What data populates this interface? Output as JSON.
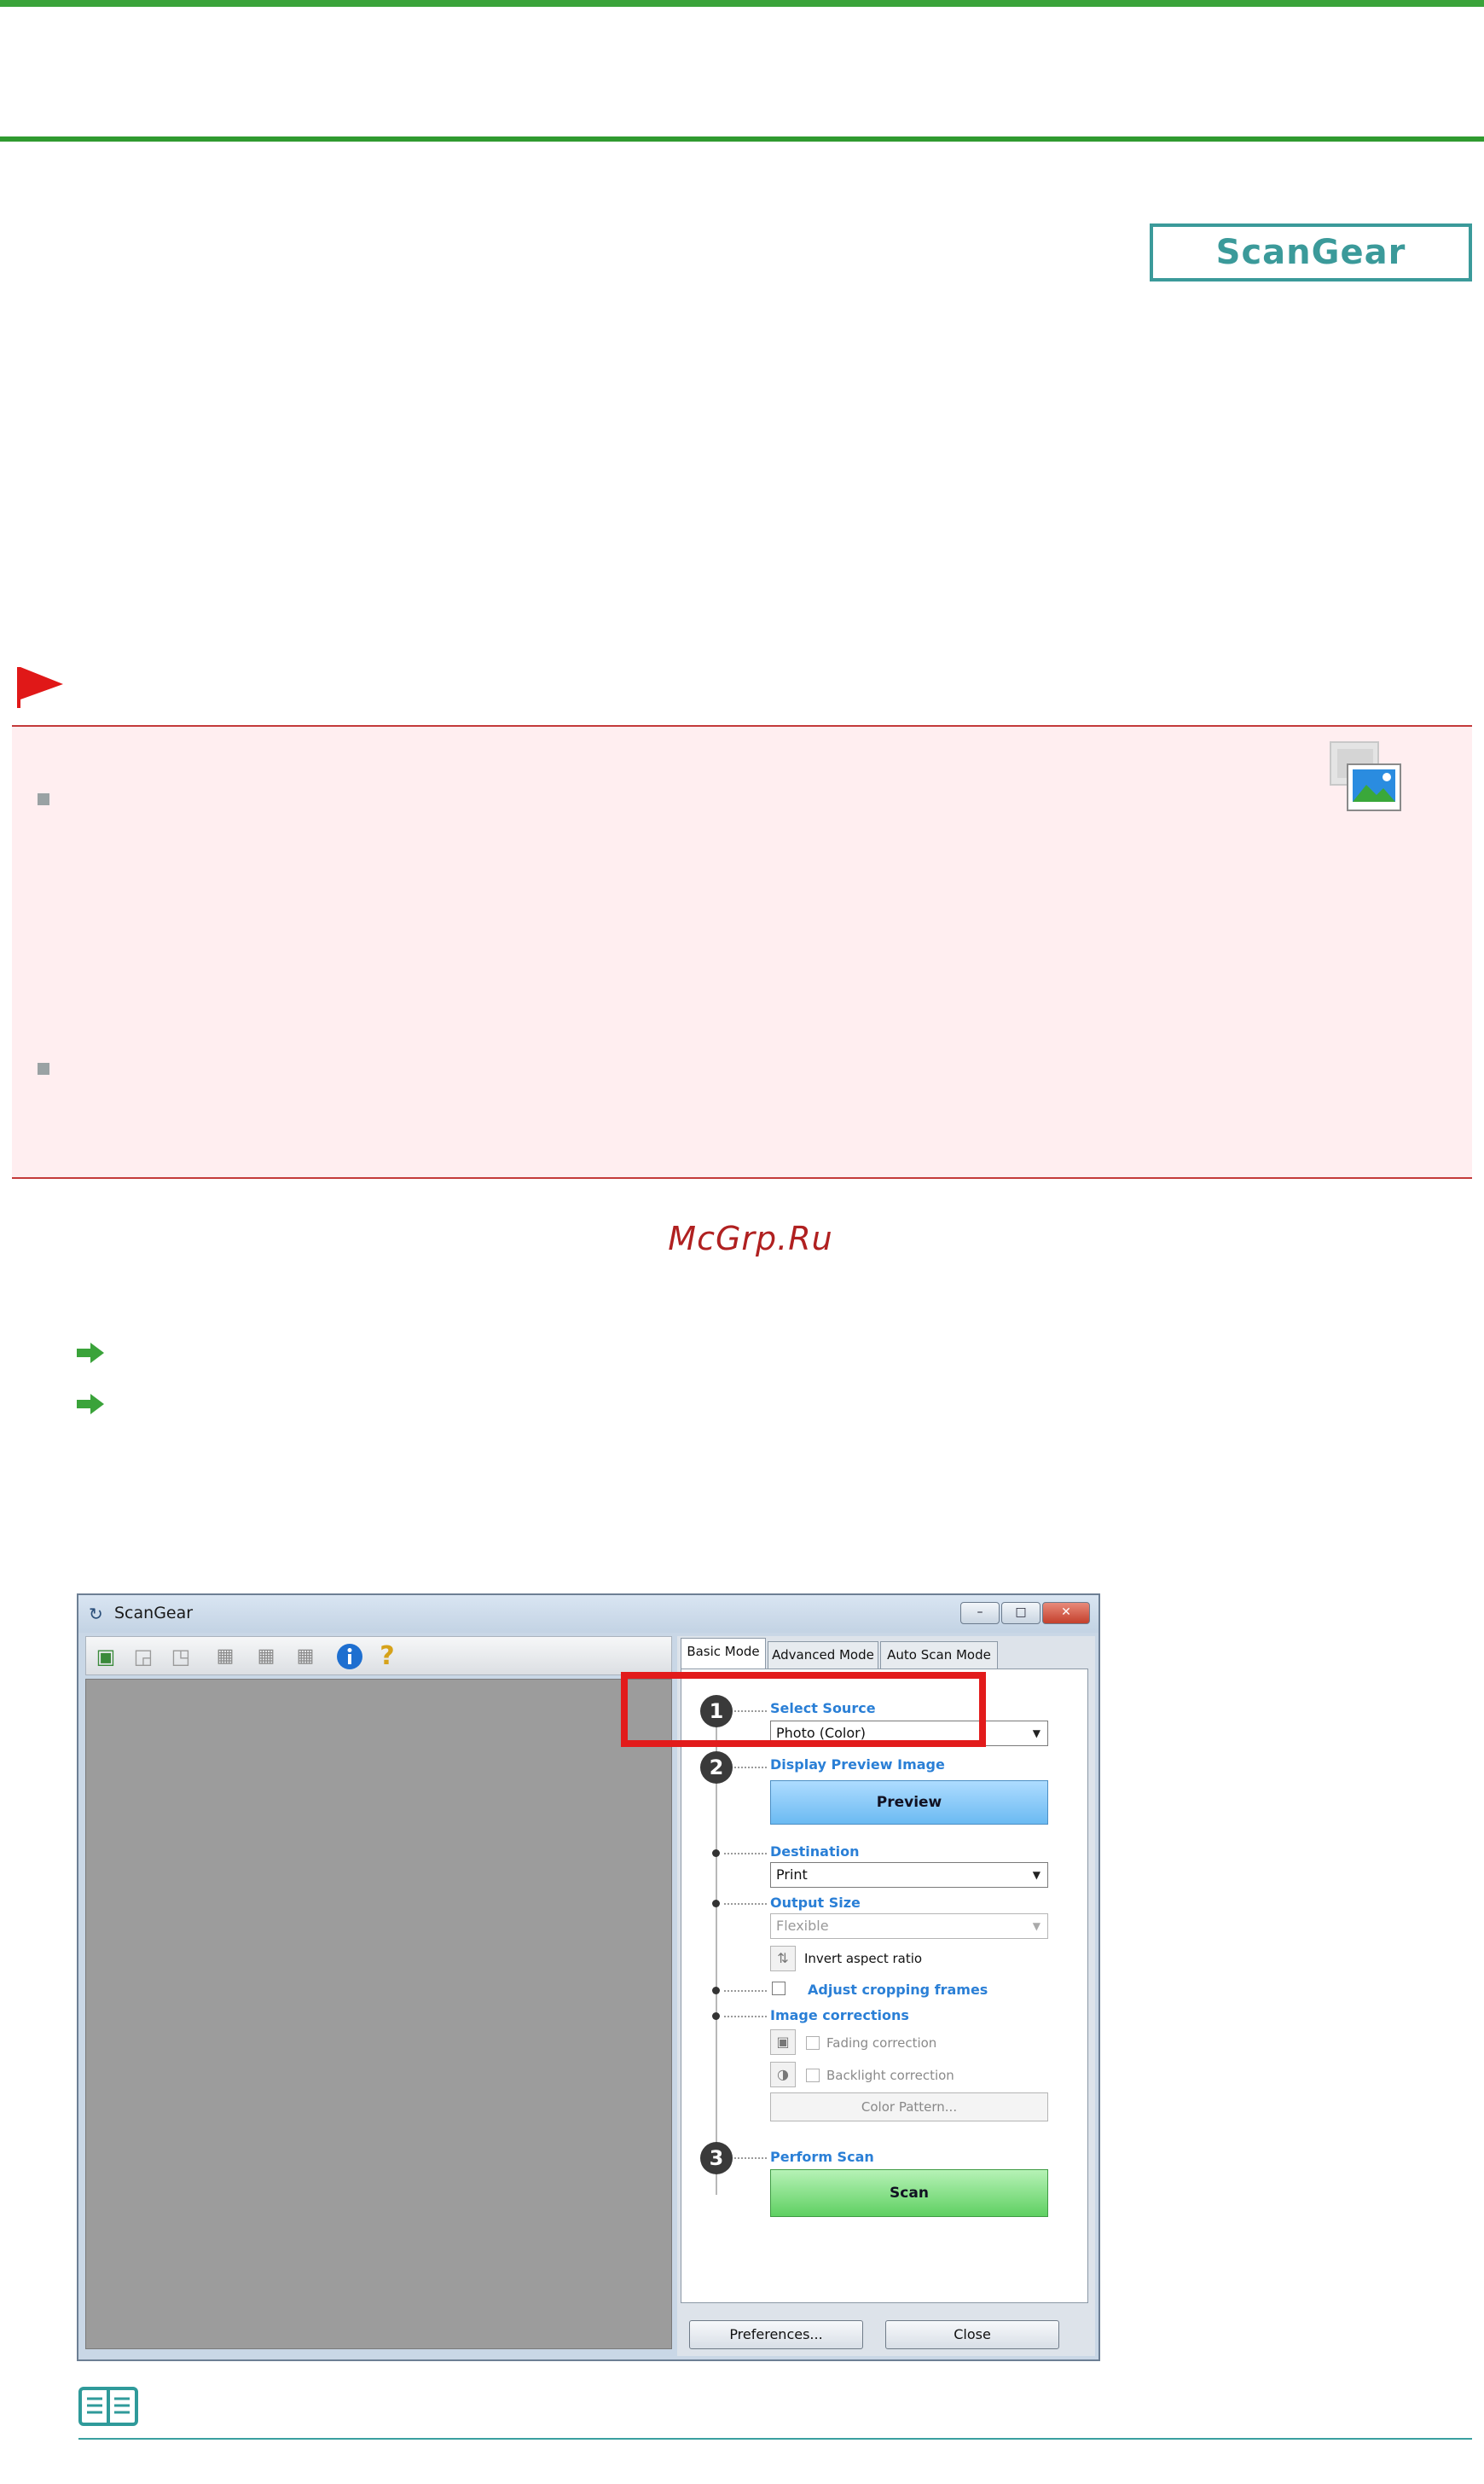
{
  "header": {
    "badge_label": "ScanGear"
  },
  "watermark": {
    "text": "McGrp.Ru"
  },
  "window": {
    "title": "ScanGear",
    "tabs": [
      "Basic Mode",
      "Advanced Mode",
      "Auto Scan Mode"
    ],
    "steps": {
      "step1": {
        "number": "1",
        "label": "Select Source",
        "value": "Photo (Color)"
      },
      "step2": {
        "number": "2",
        "label": "Display Preview Image",
        "button": "Preview"
      },
      "destination": {
        "label": "Destination",
        "value": "Print"
      },
      "output_size": {
        "label": "Output Size",
        "value": "Flexible",
        "invert_label": "Invert aspect ratio"
      },
      "adjust": {
        "label": "Adjust cropping frames"
      },
      "corrections": {
        "label": "Image corrections",
        "fading": "Fading correction",
        "backlight": "Backlight correction",
        "color_pattern": "Color Pattern..."
      },
      "step3": {
        "number": "3",
        "label": "Perform Scan",
        "button": "Scan"
      }
    },
    "footer": {
      "preferences": "Preferences...",
      "close": "Close"
    },
    "window_buttons": {
      "min": "–",
      "max": "□",
      "close": "✕"
    }
  },
  "colors": {
    "accent_green": "#3aa33a",
    "badge_teal": "#3b9a9a",
    "important_red": "#c43a3a",
    "highlight_red": "#e21b1b"
  }
}
